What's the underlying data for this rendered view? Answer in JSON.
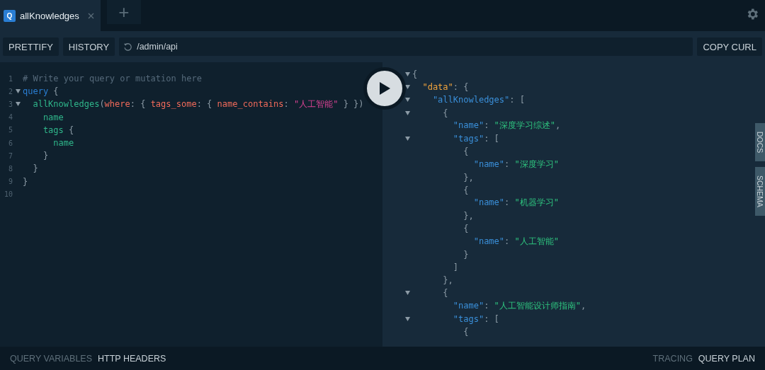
{
  "tabs": [
    {
      "icon_letter": "Q",
      "label": "allKnowledges",
      "selected": true
    },
    {
      "kind": "add",
      "label": "+",
      "selected": false
    }
  ],
  "toolbar": {
    "buttons": [
      "PRETTIFY",
      "HISTORY"
    ],
    "url": "/admin/api",
    "copy_button": "COPY CURL"
  },
  "editor": {
    "lines": [
      {
        "number": "1",
        "foldable": false,
        "tokens": [
          {
            "kind": "comment",
            "text": "# Write your query or mutation here"
          }
        ]
      },
      {
        "number": "2",
        "foldable": true,
        "tokens": [
          {
            "kind": "keyword",
            "text": "query"
          },
          {
            "kind": "punct",
            "text": " {"
          }
        ]
      },
      {
        "number": "3",
        "foldable": true,
        "tokens": [
          {
            "kind": "field",
            "text": "  allKnowledges"
          },
          {
            "kind": "punct",
            "text": "("
          },
          {
            "kind": "arg",
            "text": "where"
          },
          {
            "kind": "punct",
            "text": ": { "
          },
          {
            "kind": "arg",
            "text": "tags_some"
          },
          {
            "kind": "punct",
            "text": ": { "
          },
          {
            "kind": "arg",
            "text": "name_contains"
          },
          {
            "kind": "punct",
            "text": ": "
          },
          {
            "kind": "string",
            "text": "\"人工智能\""
          },
          {
            "kind": "punct",
            "text": " } })"
          }
        ]
      },
      {
        "number": "4",
        "foldable": false,
        "tokens": [
          {
            "kind": "field",
            "text": "    name"
          }
        ]
      },
      {
        "number": "5",
        "foldable": false,
        "tokens": [
          {
            "kind": "field",
            "text": "    tags"
          },
          {
            "kind": "punct",
            "text": " {"
          }
        ]
      },
      {
        "number": "6",
        "foldable": false,
        "tokens": [
          {
            "kind": "field",
            "text": "      name"
          }
        ]
      },
      {
        "number": "7",
        "foldable": false,
        "tokens": [
          {
            "kind": "punct",
            "text": "    }"
          }
        ]
      },
      {
        "number": "8",
        "foldable": false,
        "tokens": [
          {
            "kind": "punct",
            "text": "  }"
          }
        ]
      },
      {
        "number": "9",
        "foldable": false,
        "tokens": [
          {
            "kind": "punct",
            "text": "}"
          }
        ]
      },
      {
        "number": "10",
        "foldable": false
      }
    ]
  },
  "result": {
    "lines": [
      {
        "foldable": true,
        "tokens": [
          {
            "kind": "punct",
            "text": "{"
          }
        ]
      },
      {
        "foldable": true,
        "tokens": [
          {
            "kind": "rootkey",
            "text": "  \"data\""
          },
          {
            "kind": "punct",
            "text": ": {"
          }
        ]
      },
      {
        "foldable": true,
        "tokens": [
          {
            "kind": "key",
            "text": "    \"allKnowledges\""
          },
          {
            "kind": "punct",
            "text": ": ["
          }
        ]
      },
      {
        "foldable": true,
        "tokens": [
          {
            "kind": "punct",
            "text": "      {"
          }
        ]
      },
      {
        "foldable": false,
        "tokens": [
          {
            "kind": "key",
            "text": "        \"name\""
          },
          {
            "kind": "punct",
            "text": ": "
          },
          {
            "kind": "string",
            "text": "\"深度学习综述\""
          },
          {
            "kind": "punct",
            "text": ","
          }
        ]
      },
      {
        "foldable": true,
        "tokens": [
          {
            "kind": "key",
            "text": "        \"tags\""
          },
          {
            "kind": "punct",
            "text": ": ["
          }
        ]
      },
      {
        "foldable": false,
        "tokens": [
          {
            "kind": "punct",
            "text": "          {"
          }
        ]
      },
      {
        "foldable": false,
        "tokens": [
          {
            "kind": "key",
            "text": "            \"name\""
          },
          {
            "kind": "punct",
            "text": ": "
          },
          {
            "kind": "string",
            "text": "\"深度学习\""
          }
        ]
      },
      {
        "foldable": false,
        "tokens": [
          {
            "kind": "punct",
            "text": "          },"
          }
        ]
      },
      {
        "foldable": false,
        "tokens": [
          {
            "kind": "punct",
            "text": "          {"
          }
        ]
      },
      {
        "foldable": false,
        "tokens": [
          {
            "kind": "key",
            "text": "            \"name\""
          },
          {
            "kind": "punct",
            "text": ": "
          },
          {
            "kind": "string",
            "text": "\"机器学习\""
          }
        ]
      },
      {
        "foldable": false,
        "tokens": [
          {
            "kind": "punct",
            "text": "          },"
          }
        ]
      },
      {
        "foldable": false,
        "tokens": [
          {
            "kind": "punct",
            "text": "          {"
          }
        ]
      },
      {
        "foldable": false,
        "tokens": [
          {
            "kind": "key",
            "text": "            \"name\""
          },
          {
            "kind": "punct",
            "text": ": "
          },
          {
            "kind": "string",
            "text": "\"人工智能\""
          }
        ]
      },
      {
        "foldable": false,
        "tokens": [
          {
            "kind": "punct",
            "text": "          }"
          }
        ]
      },
      {
        "foldable": false,
        "tokens": [
          {
            "kind": "punct",
            "text": "        ]"
          }
        ]
      },
      {
        "foldable": false,
        "tokens": [
          {
            "kind": "punct",
            "text": "      },"
          }
        ]
      },
      {
        "foldable": true,
        "tokens": [
          {
            "kind": "punct",
            "text": "      {"
          }
        ]
      },
      {
        "foldable": false,
        "tokens": [
          {
            "kind": "key",
            "text": "        \"name\""
          },
          {
            "kind": "punct",
            "text": ": "
          },
          {
            "kind": "string",
            "text": "\"人工智能设计师指南\""
          },
          {
            "kind": "punct",
            "text": ","
          }
        ]
      },
      {
        "foldable": true,
        "tokens": [
          {
            "kind": "key",
            "text": "        \"tags\""
          },
          {
            "kind": "punct",
            "text": ": ["
          }
        ]
      },
      {
        "foldable": false,
        "tokens": [
          {
            "kind": "punct",
            "text": "          {"
          }
        ]
      }
    ]
  },
  "side_tabs": [
    "DOCS",
    "SCHEMA"
  ],
  "footer": {
    "left": [
      {
        "label": "QUERY VARIABLES",
        "selected": false
      },
      {
        "label": "HTTP HEADERS",
        "selected": true
      }
    ],
    "right": [
      {
        "label": "TRACING",
        "selected": false
      },
      {
        "label": "QUERY PLAN",
        "selected": true
      }
    ]
  }
}
